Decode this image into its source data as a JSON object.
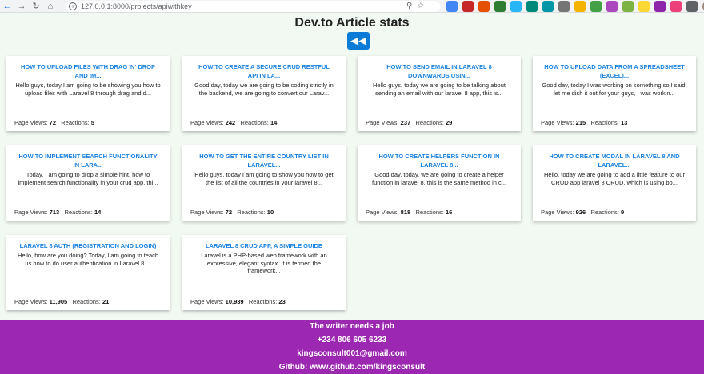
{
  "browser": {
    "url": "127.0.0.1:8000/projects/apiwithkey",
    "extensions": [
      {
        "icon": "zoom-icon",
        "color": "#5f6368"
      },
      {
        "icon": "star-icon",
        "color": "#5f6368"
      },
      {
        "icon": "ext-blue-icon",
        "color": "#4285f4"
      },
      {
        "icon": "ext-red-icon",
        "color": "#c62828"
      },
      {
        "icon": "ext-orange-icon",
        "color": "#e65100"
      },
      {
        "icon": "ext-green-icon",
        "color": "#2e7d32"
      },
      {
        "icon": "ext-lightblue-icon",
        "color": "#29b6f6"
      },
      {
        "icon": "ext-teal-icon",
        "color": "#00897b"
      },
      {
        "icon": "ext-cyan-icon",
        "color": "#0097a7"
      },
      {
        "icon": "ext-gray-icon",
        "color": "#757575"
      },
      {
        "icon": "ext-multicolor-icon",
        "color": "#f4b400"
      },
      {
        "icon": "ext-green2-icon",
        "color": "#43a047"
      },
      {
        "icon": "ext-rainbow-icon",
        "color": "#ab47bc"
      },
      {
        "icon": "ext-lime-icon",
        "color": "#7cb342"
      },
      {
        "icon": "ext-yellow-icon",
        "color": "#fdd835"
      },
      {
        "icon": "ext-purple-icon",
        "color": "#8e24aa"
      },
      {
        "icon": "ext-pink-icon",
        "color": "#ec407a"
      },
      {
        "icon": "puzzle-icon",
        "color": "#5f6368"
      },
      {
        "icon": "avatar-icon",
        "color": "#a1887f"
      }
    ]
  },
  "page": {
    "title": "Dev.to Article stats",
    "back_symbol": "◀◀"
  },
  "labels": {
    "page_views": "Page Views:",
    "reactions": "Reactions:"
  },
  "articles": [
    {
      "title": "HOW TO UPLOAD FILES WITH DRAG 'N' DROP AND IM...",
      "excerpt": "Hello guys, today I am going to be showing you how to upload files with Laravel 8 through drag and d...",
      "views": "72",
      "reactions": "5"
    },
    {
      "title": "HOW TO CREATE A SECURE CRUD RESTFUL API IN LA...",
      "excerpt": "Good day, today we are going to be coding strictly in the backend, we are going to convert our Larav...",
      "views": "242",
      "reactions": "14"
    },
    {
      "title": "HOW TO SEND EMAIL IN LARAVEL 8 DOWNWARDS USIN...",
      "excerpt": "Hello guys, today we are going to be talking about sending an email with our laravel 8 app, this is...",
      "views": "237",
      "reactions": "29"
    },
    {
      "title": "HOW TO UPLOAD DATA FROM A SPREADSHEET (EXCEL)...",
      "excerpt": "Good day, today I was working on something so I said, let me dish it out for your guys, I was workin...",
      "views": "215",
      "reactions": "13"
    },
    {
      "title": "HOW TO IMPLEMENT SEARCH FUNCTIONALITY IN LARA...",
      "excerpt": "Today, I am going to drop a simple hint, how to implement search functionality in your crud app, thi...",
      "views": "713",
      "reactions": "14"
    },
    {
      "title": "HOW TO GET THE ENTIRE COUNTRY LIST IN LARAVEL...",
      "excerpt": "Hello guys, today I am going to show you how to get the list of all the countries in your laravel 8...",
      "views": "72",
      "reactions": "10"
    },
    {
      "title": "HOW TO CREATE HELPERS FUNCTION IN LARAVEL 8...",
      "excerpt": "Good day, today, we are going to create a helper function in laravel 8, this is the same method in c...",
      "views": "818",
      "reactions": "16"
    },
    {
      "title": "HOW TO CREATE MODAL IN LARAVEL 8 AND LARAVEL...",
      "excerpt": "Hello, today we are going to add a little feature to our CRUD app laravel 8 CRUD, which is using bo...",
      "views": "926",
      "reactions": "9"
    },
    {
      "title": "LARAVEL 8 AUTH (REGISTRATION AND LOGIN)",
      "excerpt": "Hello, how are you doing? Today, I am going to teach us how to do user authentication in Laravel 8....",
      "views": "11,905",
      "reactions": "21"
    },
    {
      "title": "LARAVEL 8 CRUD APP, A SIMPLE GUIDE",
      "excerpt": "Laravel is a PHP-based web framework with an expressive, elegant syntax. It is termed the framework...",
      "views": "10,939",
      "reactions": "23"
    }
  ],
  "footer": {
    "line1": "The writer needs a job",
    "line2": "+234 806 605 6233",
    "line3": "kingsconsult001@gmail.com",
    "line4": "Github: www.github.com/kingsconsult",
    "bg_color": "#9c27b0"
  },
  "accent_color": "#1a82e2"
}
